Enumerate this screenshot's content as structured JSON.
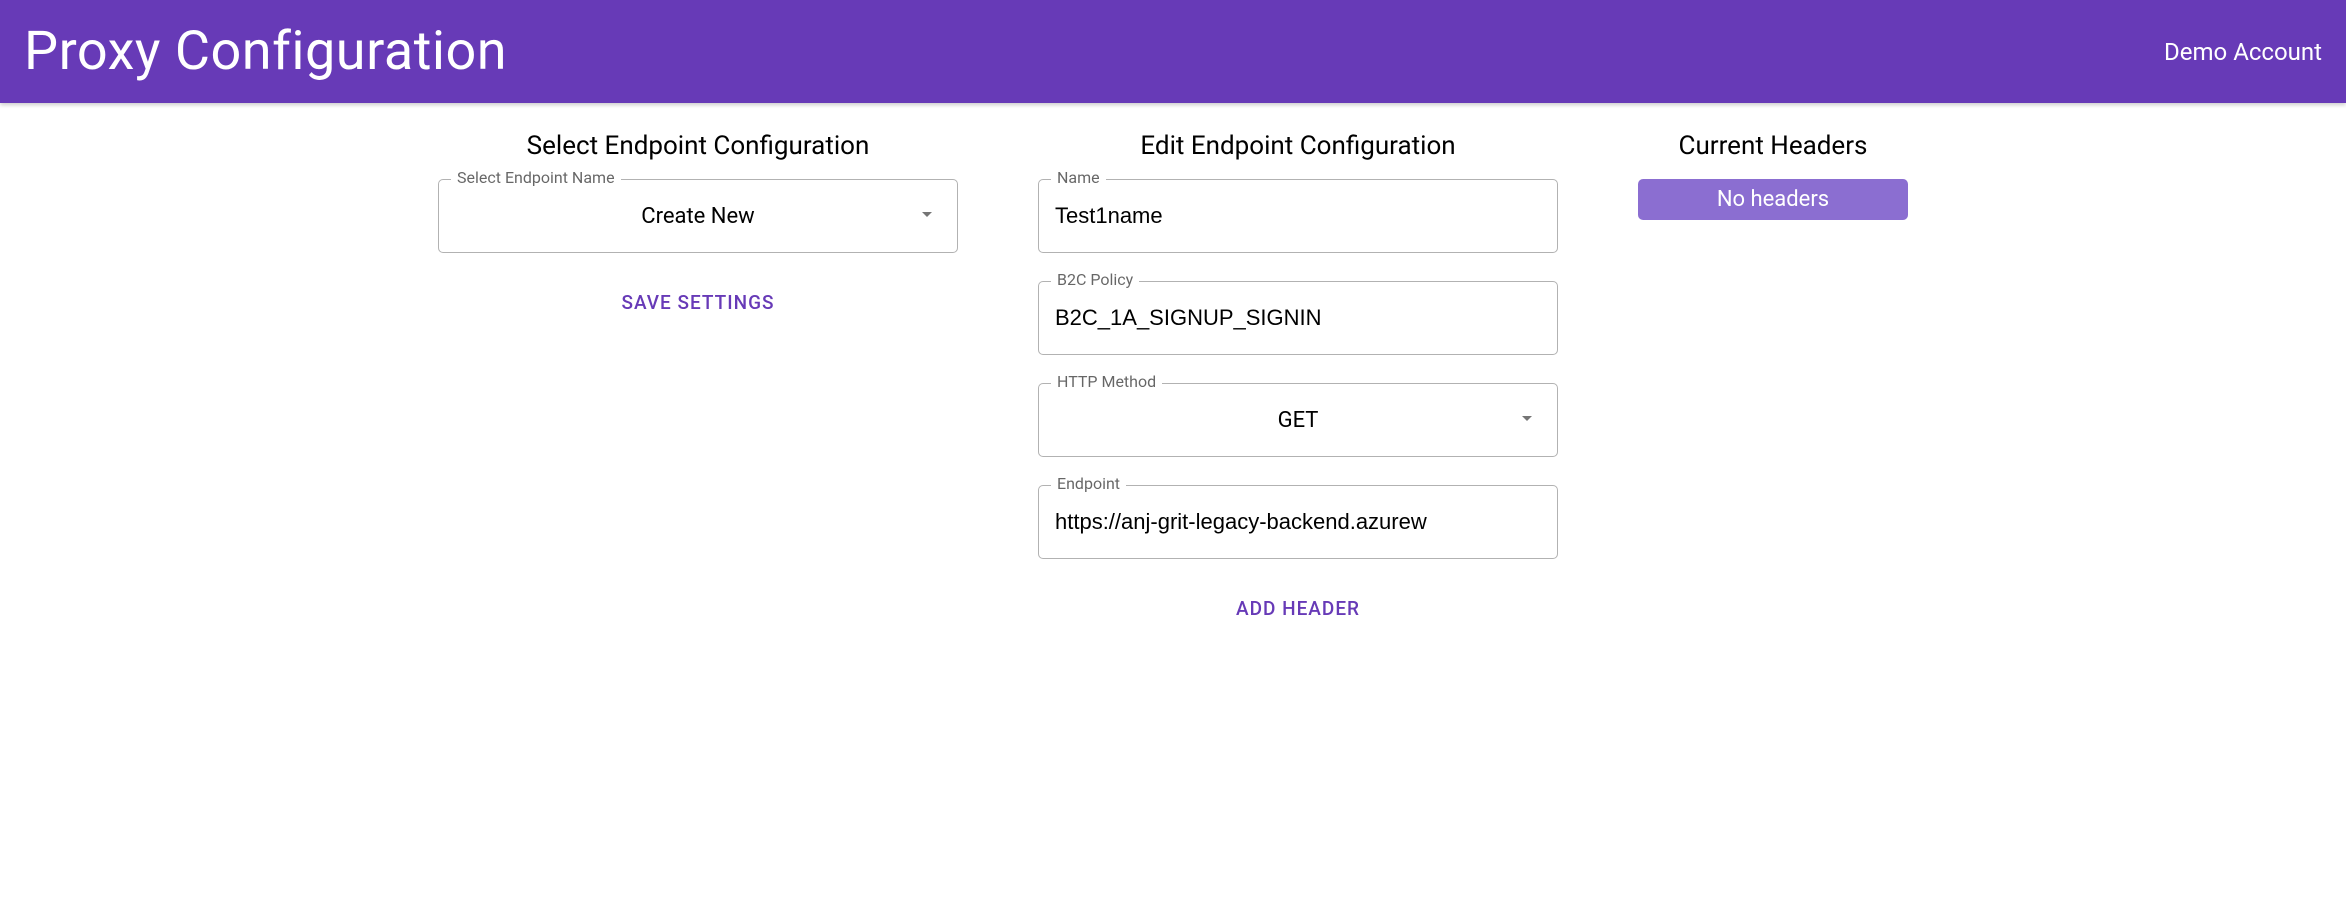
{
  "header": {
    "title": "Proxy Configuration",
    "account": "Demo Account"
  },
  "select_section": {
    "title": "Select Endpoint Configuration",
    "endpoint_name": {
      "label": "Select Endpoint Name",
      "value": "Create New"
    },
    "save_button": "Save Settings"
  },
  "edit_section": {
    "title": "Edit Endpoint Configuration",
    "name": {
      "label": "Name",
      "value": "Test1name"
    },
    "b2c_policy": {
      "label": "B2C Policy",
      "value": "B2C_1A_SIGNUP_SIGNIN"
    },
    "http_method": {
      "label": "HTTP Method",
      "value": "GET"
    },
    "endpoint": {
      "label": "Endpoint",
      "value": "https://anj-grit-legacy-backend.azurew"
    },
    "add_header_button": "Add Header"
  },
  "headers_section": {
    "title": "Current Headers",
    "empty_text": "No headers"
  }
}
